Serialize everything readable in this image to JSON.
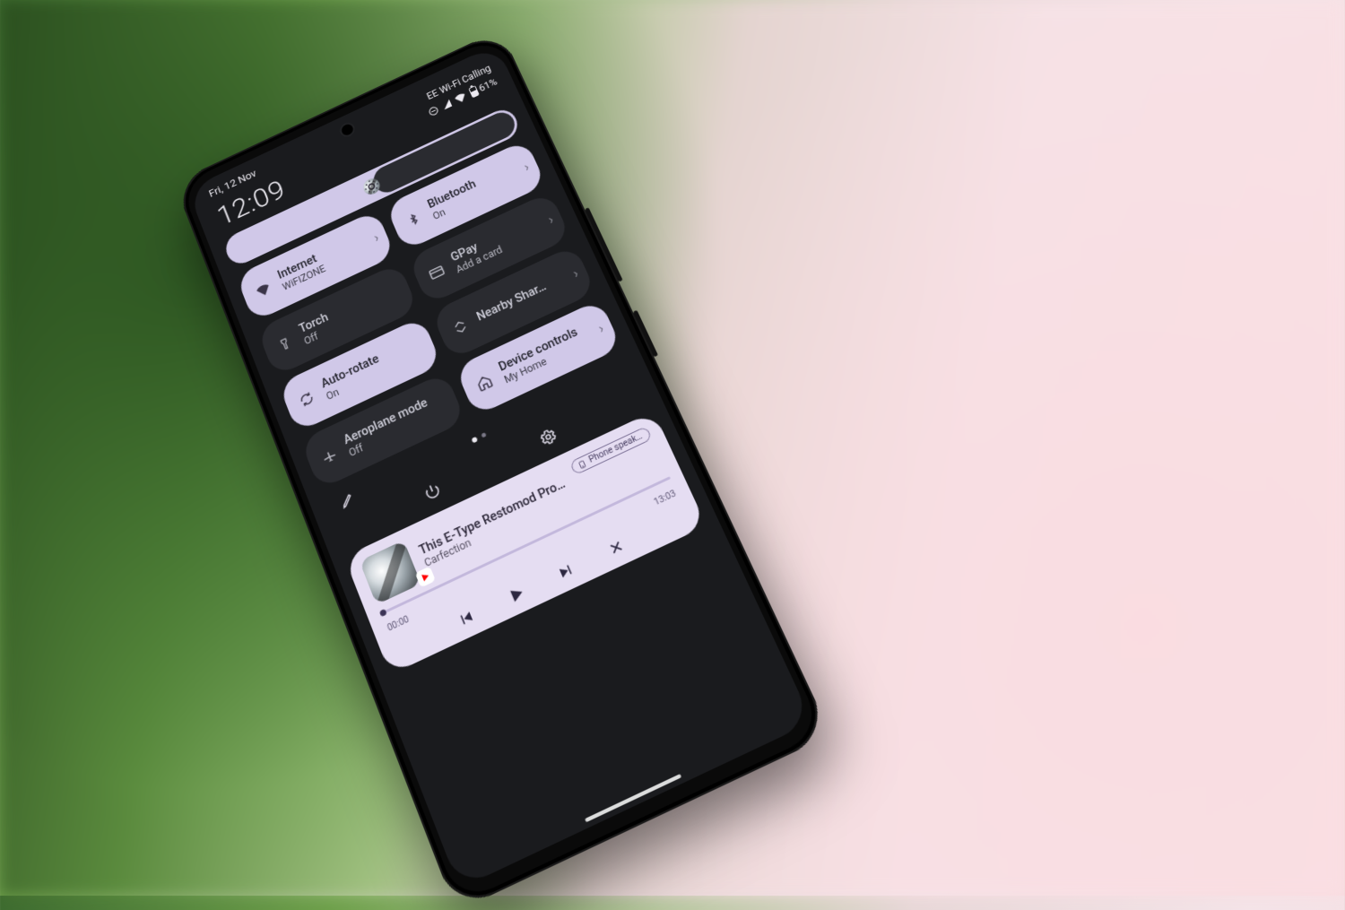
{
  "status": {
    "date": "Fri, 12 Nov",
    "time": "12:09",
    "carrier": "EE Wi-Fi Calling",
    "battery_pct": "61%"
  },
  "tiles": {
    "internet": {
      "title": "Internet",
      "sub": "WiFIZONE"
    },
    "bluetooth": {
      "title": "Bluetooth",
      "sub": "On"
    },
    "torch": {
      "title": "Torch",
      "sub": "Off"
    },
    "gpay": {
      "title": "GPay",
      "sub": "Add a card"
    },
    "autorotate": {
      "title": "Auto-rotate",
      "sub": "On"
    },
    "nearby": {
      "title": "Nearby Shar…",
      "sub": ""
    },
    "aeroplane": {
      "title": "Aeroplane mode",
      "sub": "Off"
    },
    "device": {
      "title": "Device controls",
      "sub": "My Home"
    }
  },
  "media": {
    "title": "This E-Type Restomod Prot…",
    "artist": "Carfection",
    "output": "Phone speak…",
    "elapsed": "00:00",
    "duration": "13:03"
  }
}
